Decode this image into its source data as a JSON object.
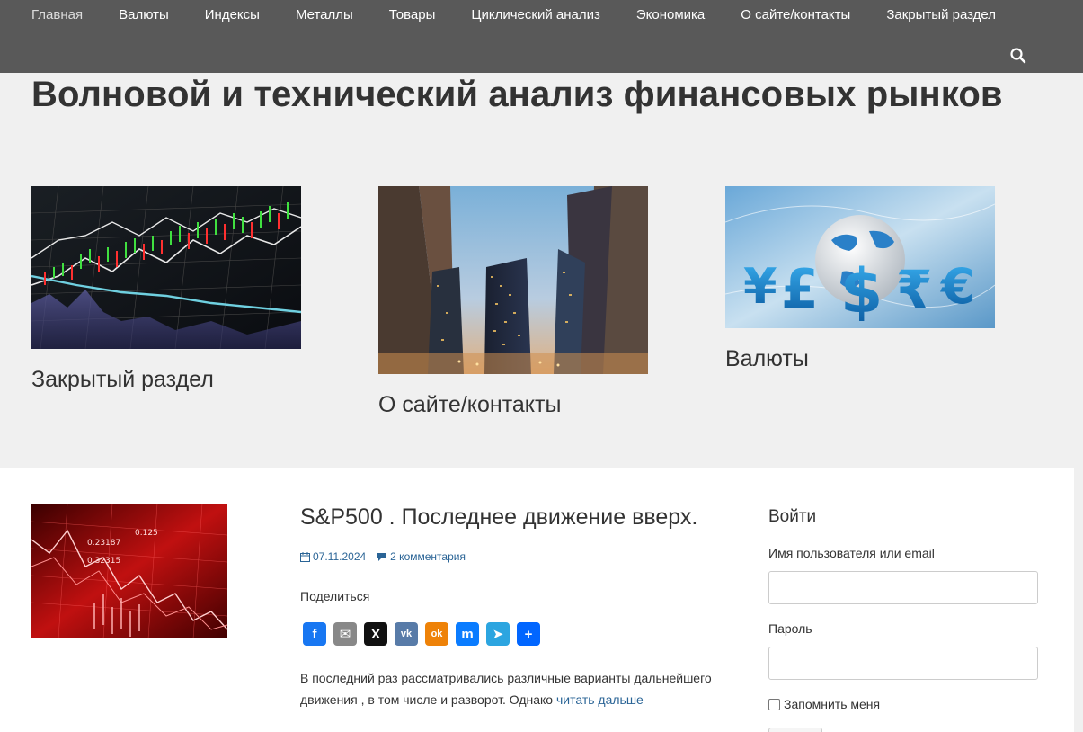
{
  "nav": {
    "items": [
      {
        "label": "Главная",
        "active": true
      },
      {
        "label": "Валюты"
      },
      {
        "label": "Индексы"
      },
      {
        "label": "Металлы"
      },
      {
        "label": "Товары"
      },
      {
        "label": "Циклический анализ"
      },
      {
        "label": "Экономика"
      },
      {
        "label": "О сайте/контакты"
      },
      {
        "label": "Закрытый раздел"
      }
    ],
    "search_icon": "search-icon"
  },
  "site_title": "Волновой и технический анализ финансовых рынков",
  "featured": [
    {
      "label": "Закрытый раздел",
      "image": "stock-chart-image"
    },
    {
      "label": "О сайте/контакты",
      "image": "skyscrapers-image"
    },
    {
      "label": "Валюты",
      "image": "currency-globe-image"
    }
  ],
  "post": {
    "title": "S&P500 . Последнее движение вверх.",
    "date": "07.11.2024",
    "comments": "2 комментария",
    "share_label": "Поделиться",
    "share_services": [
      {
        "name": "facebook-icon",
        "glyph": "f",
        "color": "#1877f2"
      },
      {
        "name": "email-icon",
        "glyph": "✉",
        "color": "#888888"
      },
      {
        "name": "x-icon",
        "glyph": "X",
        "color": "#111111"
      },
      {
        "name": "vk-icon",
        "glyph": "vk",
        "color": "#587ba8"
      },
      {
        "name": "odnoklassniki-icon",
        "glyph": "ok",
        "color": "#ee8208"
      },
      {
        "name": "messenger-icon",
        "glyph": "m",
        "color": "#0a7cff"
      },
      {
        "name": "telegram-icon",
        "glyph": "➤",
        "color": "#2ca5e0"
      },
      {
        "name": "share-plus-icon",
        "glyph": "+",
        "color": "#0166ff"
      }
    ],
    "excerpt": "В последний раз рассматривались различные варианты дальнейшего движения , в том числе и разворот. Однако ",
    "read_more": "читать дальше"
  },
  "login": {
    "title": "Войти",
    "username_label": "Имя пользователя или email",
    "password_label": "Пароль",
    "remember_label": "Запомнить меня"
  }
}
